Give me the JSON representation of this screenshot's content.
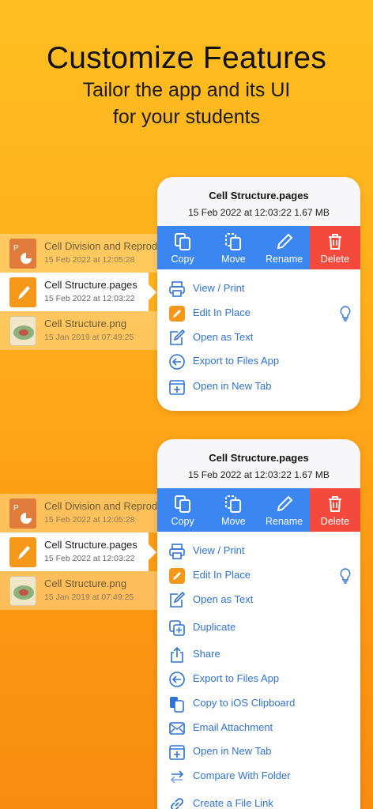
{
  "header": {
    "title": "Customize Features",
    "subtitle_line1": "Tailor the app and its UI",
    "subtitle_line2": "for your students"
  },
  "files": [
    {
      "name": "Cell Division and Reprod",
      "date": "15 Feb 2022 at 12:05:28",
      "icon": "presentation-file-icon"
    },
    {
      "name": "Cell Structure.pages",
      "date": "15 Feb 2022 at 12:03:22",
      "icon": "pages-file-icon"
    },
    {
      "name": "Cell Structure.png",
      "date": "15 Jan 2019 at 07:49:25",
      "icon": "image-file-icon"
    }
  ],
  "popover": {
    "title": "Cell Structure.pages",
    "meta": "15 Feb 2022 at 12:03:22    1.67 MB",
    "actions": [
      "Copy",
      "Move",
      "Rename",
      "Delete"
    ]
  },
  "menu_short": [
    "View / Print",
    "Edit In Place",
    "Open as Text",
    "Export to Files App",
    "Open in New Tab"
  ],
  "menu_long": [
    "View / Print",
    "Edit In Place",
    "Open as Text",
    "Duplicate",
    "Share",
    "Export to Files App",
    "Copy to iOS Clipboard",
    "Email Attachment",
    "Open in New Tab",
    "Compare With Folder",
    "Create a File Link"
  ],
  "colors": {
    "accent": "#3b86f1",
    "delete": "#f44a3e",
    "link": "#2f73d6",
    "background": "#ffb01c"
  }
}
